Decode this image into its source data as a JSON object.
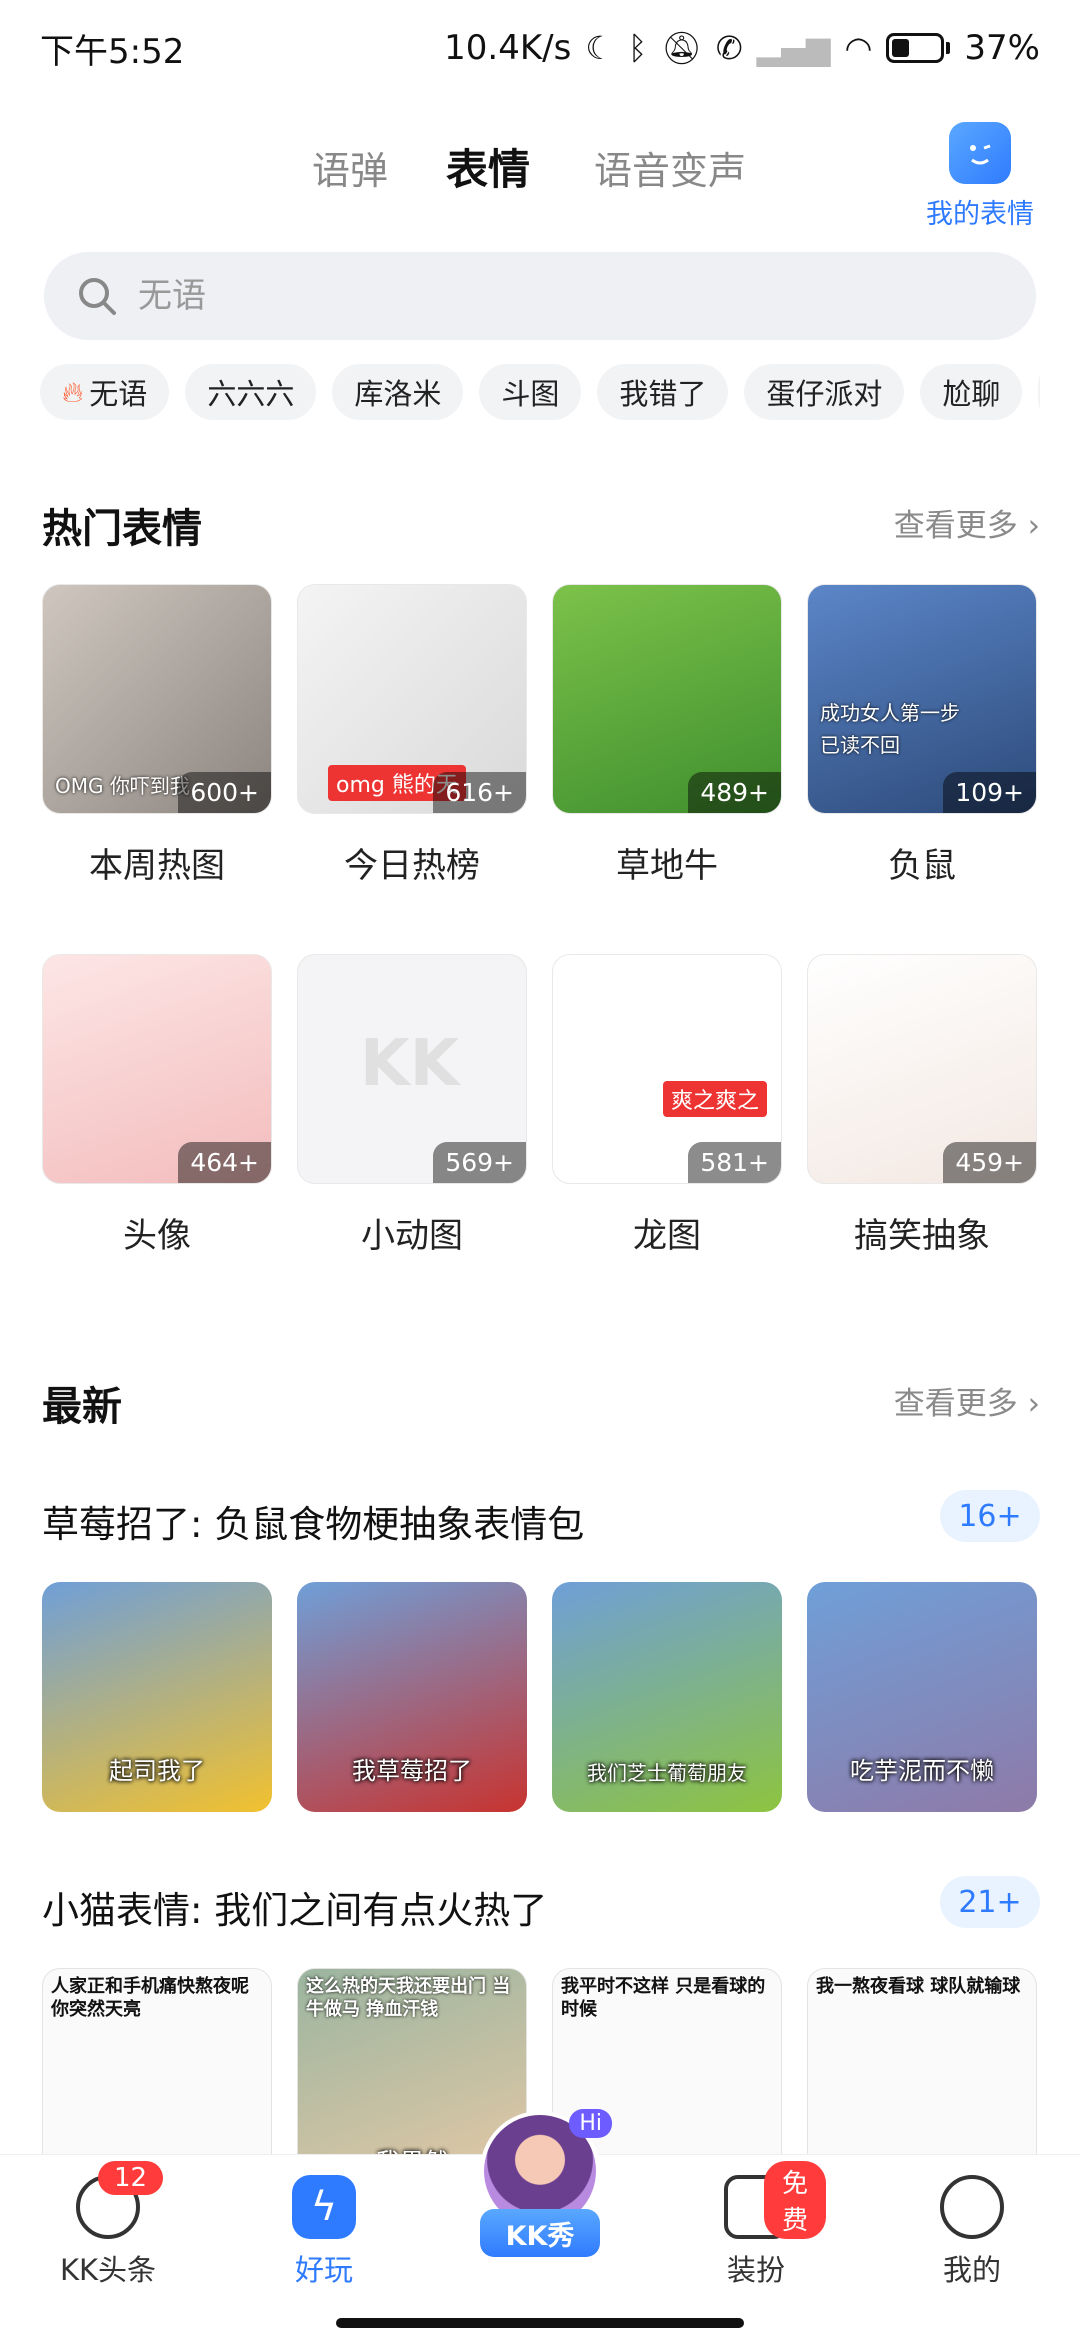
{
  "status_bar": {
    "time": "下午5:52",
    "net_speed": "10.4K/s",
    "battery": "37%",
    "battery_level": 0.37,
    "icons": [
      "moon-icon",
      "bluetooth-icon",
      "bell-off-icon",
      "call-blocked-icon",
      "signal-icon",
      "wifi-icon"
    ]
  },
  "tabs": [
    {
      "label": "语弹",
      "active": false
    },
    {
      "label": "表情",
      "active": true
    },
    {
      "label": "语音变声",
      "active": false
    }
  ],
  "my_emoji": {
    "label": "我的表情",
    "icon": "emoji-face-icon"
  },
  "search": {
    "placeholder": "无语"
  },
  "chips": [
    {
      "label": "无语",
      "hot": true
    },
    {
      "label": "六六六"
    },
    {
      "label": "库洛米"
    },
    {
      "label": "斗图"
    },
    {
      "label": "我错了"
    },
    {
      "label": "蛋仔派对"
    },
    {
      "label": "尬聊"
    }
  ],
  "hot": {
    "title": "热门表情",
    "see_more": "查看更多",
    "items": [
      {
        "label": "本周热图",
        "count": "600+",
        "caption": "OMG 你吓到我",
        "bg": "linear-gradient(135deg,#cfc7bf,#8c8580)"
      },
      {
        "label": "今日热榜",
        "count": "616+",
        "caption": "omg 熊的天",
        "bg": "linear-gradient(135deg,#f4f4f4,#d9d9d9)"
      },
      {
        "label": "草地牛",
        "count": "489+",
        "caption": "",
        "bg": "linear-gradient(160deg,#7cc24a,#3f8f2e)"
      },
      {
        "label": "负鼠",
        "count": "109+",
        "caption": "成功女人第一步 已读不回",
        "bg": "linear-gradient(160deg,#5b86c8,#2d4a7a)"
      },
      {
        "label": "头像",
        "count": "464+",
        "caption": "",
        "bg": "linear-gradient(160deg,#fde6e6,#f3bcbc)"
      },
      {
        "label": "小动图",
        "count": "569+",
        "caption": "",
        "bg": "#f4f4f6"
      },
      {
        "label": "龙图",
        "count": "581+",
        "caption": "爽之爽之",
        "bg": "#ffffff"
      },
      {
        "label": "搞笑抽象",
        "count": "459+",
        "caption": "",
        "bg": "linear-gradient(160deg,#ffffff,#f3e8e2)"
      }
    ]
  },
  "latest": {
    "title": "最新",
    "see_more": "查看更多",
    "sets": [
      {
        "title": "草莓招了: 负鼠食物梗抽象表情包",
        "badge": "16+",
        "items": [
          {
            "caption": "起司我了",
            "top": "",
            "bg": "linear-gradient(160deg,#6f9fd8,#f2c12e)"
          },
          {
            "caption": "我草莓招了",
            "top": "",
            "bg": "linear-gradient(160deg,#6f9fd8,#c8332f)"
          },
          {
            "caption": "我们芝士葡萄朋友",
            "top": "",
            "bg": "linear-gradient(160deg,#6f9fd8,#8dc43f)"
          },
          {
            "caption": "吃芋泥而不懒",
            "top": "",
            "bg": "linear-gradient(160deg,#6f9fd8,#8e7aa8)"
          }
        ]
      },
      {
        "title": "小猫表情: 我们之间有点火热了",
        "badge": "21+",
        "items": [
          {
            "caption": "",
            "top": "人家正和手机痛快熬夜呢 你突然天亮",
            "bg": "#fafafa"
          },
          {
            "caption": "我果然",
            "top": "这么热的天我还要出门 当牛做马 挣血汗钱",
            "bg": "linear-gradient(160deg,#9bb5a0,#e7c9a6)"
          },
          {
            "caption": "",
            "top": "我平时不这样 只是看球的时候",
            "bg": "#fafafa"
          },
          {
            "caption": "",
            "top": "我一熬夜看球 球队就输球",
            "bg": "#fafafa"
          }
        ]
      }
    ]
  },
  "bottom_nav": {
    "items": [
      {
        "label": "KK头条",
        "icon": "planet-icon",
        "badge": "12"
      },
      {
        "label": "好玩",
        "icon": "lightning-icon",
        "active": true
      },
      {
        "label": "装扮",
        "icon": "tshirt-icon",
        "badge": "免费"
      },
      {
        "label": "我的",
        "icon": "face-icon"
      }
    ],
    "center": {
      "label": "KK秀",
      "hi": "Hi"
    }
  },
  "colors": {
    "accent": "#2f7bff",
    "highlight": "#ffd21f",
    "badge": "#ff3b3b"
  }
}
